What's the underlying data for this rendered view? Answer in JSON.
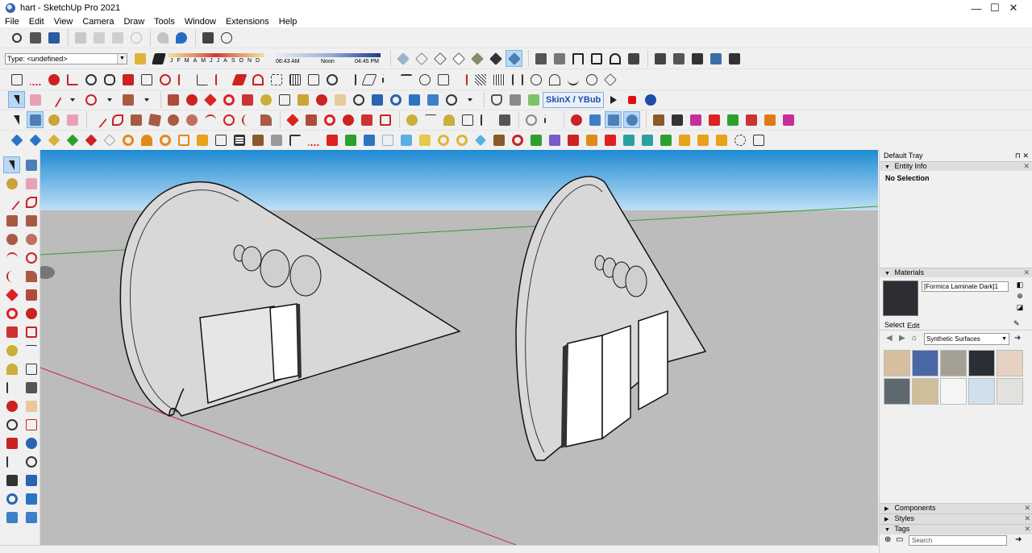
{
  "window": {
    "title": "hart - SketchUp Pro 2021",
    "controls": [
      "—",
      "☐",
      "✕"
    ]
  },
  "menubar": [
    "File",
    "Edit",
    "View",
    "Camera",
    "Draw",
    "Tools",
    "Window",
    "Extensions",
    "Help"
  ],
  "toolbar": {
    "type_selector_value": "Type: <undefined>",
    "shadow_months": [
      "J",
      "F",
      "M",
      "A",
      "M",
      "J",
      "J",
      "A",
      "S",
      "O",
      "N",
      "D"
    ],
    "time_start": "06:43 AM",
    "time_mid": "Noon",
    "time_end": "04:45 PM",
    "skinx_label_1": "SkinX / YBub"
  },
  "tray": {
    "title": "Default Tray",
    "entity_info": {
      "title": "Entity Info",
      "body": "No Selection"
    },
    "materials": {
      "title": "Materials",
      "name": "[Formica Laminate Dark]1",
      "tab_select": "Select",
      "tab_edit": "Edit",
      "collection": "Synthetic Surfaces",
      "swatch_colors": [
        "#d5bf9e",
        "#4a67a6",
        "#a4a194",
        "#2b2e35",
        "#e6d2c2",
        "#5f6a70",
        "#cfbe9a",
        "#f5f5f5",
        "#cfe0ec",
        "#e3e1dc"
      ]
    },
    "components": "Components",
    "styles": "Styles",
    "tags": "Tags",
    "search_placeholder": "Search"
  }
}
